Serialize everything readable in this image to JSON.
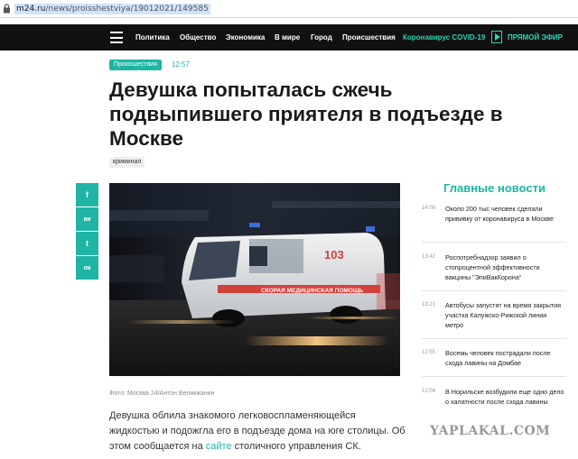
{
  "browser": {
    "url_host": "m24.ru",
    "url_path": "/news/proisshestviya/19012021/149585"
  },
  "nav": {
    "items": [
      "Политика",
      "Общество",
      "Экономика",
      "В мире",
      "Город",
      "Происшествия"
    ],
    "covid": "Коронавирус COVID-19",
    "live": "ПРЯМОЙ ЭФИР"
  },
  "article": {
    "category": "Происшествия",
    "time": "12:57",
    "title": "Девушка попыталась сжечь подвыпившего приятеля в подъезде в Москве",
    "tag": "криминал",
    "photo_caption": "Фото: Москва 24/Антон Великжанин",
    "lead_before_link": "Девушка облила знакомого легковоспламеняющейся жидкостью и подожгла его в подъезде дома на юге столицы. Об этом сообщается на ",
    "lead_link": "сайте",
    "lead_after_link": " столичного управления СК."
  },
  "share": {
    "facebook": "f",
    "vk": "вк",
    "twitter": "t",
    "odnoklassniki": "ок"
  },
  "photo": {
    "ambulance_number": "103",
    "ambulance_text": "СКОРАЯ МЕДИЦИНСКАЯ ПОМОЩЬ"
  },
  "sidebar": {
    "title": "Главные новости",
    "news": [
      {
        "time": "14:09",
        "title": "Около 200 тыс человек сделали прививку от коронавируса в Москве"
      },
      {
        "time": "13:42",
        "title": "Роспотребнадзор заявил о стопроцентной эффективности вакцины \"ЭпиВакКорона\""
      },
      {
        "time": "13:21",
        "title": "Автобусы запустят на время закрытия участка Калужско-Рижской линии метро"
      },
      {
        "time": "12:55",
        "title": "Восемь человек пострадали после схода лавины на Домбае"
      },
      {
        "time": "12:04",
        "title": "В Норильске возбудили еще одно дело о халатности после схода лавины"
      }
    ]
  },
  "watermark": "YAPLAKAL.COM",
  "colors": {
    "accent": "#1fb5a4",
    "nav_bg": "#111111"
  }
}
